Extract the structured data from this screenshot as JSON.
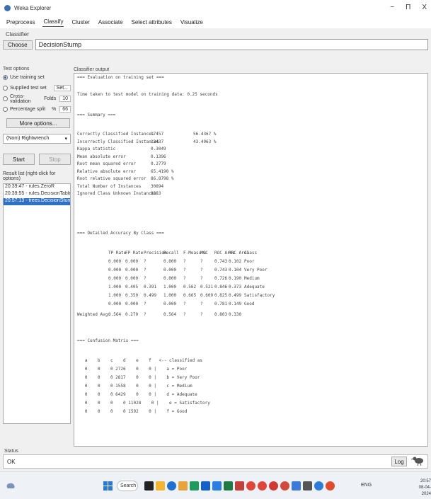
{
  "window": {
    "title": "Weka Explorer",
    "minimize": "−",
    "maximize": "Π",
    "close": "X"
  },
  "tabs": [
    "Preprocess",
    "Classify",
    "Cluster",
    "Associate",
    "Select attributes",
    "Visualize"
  ],
  "active_tab": 1,
  "classifier": {
    "section_label": "Classifier",
    "choose_label": "Choose",
    "name": "DecisionStump"
  },
  "test_options": {
    "title": "Test options",
    "use_training": "Use training set",
    "supplied": {
      "label": "Supplied test set",
      "button": "Set..."
    },
    "cross_val": {
      "label": "Cross-validation",
      "folds_label": "Folds",
      "folds": "10"
    },
    "split": {
      "label": "Percentage split",
      "pct_label": "%",
      "pct": "66"
    },
    "more_options": "More options..."
  },
  "class_select": {
    "value": "(Nom) Rightwrench",
    "arrow": "▾"
  },
  "start_label": "Start",
  "stop_label": "Stop",
  "result_list": {
    "title": "Result list (right-click for options)",
    "items": [
      "20:39:47 - rules.ZeroR",
      "20:39:55 - rules.DecisionTable",
      "20:57:13 - trees.DecisionStump"
    ]
  },
  "output": {
    "title": "Classifier output",
    "header_line": "=== Evaluation on training set ===",
    "time_line": "Time taken to test model on training data: 0.25 seconds",
    "summary_title": "=== Summary ===",
    "summary": [
      {
        "label": "Correctly Classified Instances",
        "value": "17457",
        "pct": "56.4367 %"
      },
      {
        "label": "Incorrectly Classified Instances",
        "value": "13437",
        "pct": "43.4963 %"
      },
      {
        "label": "Kappa statistic",
        "value": "0.3049"
      },
      {
        "label": "Mean absolute error",
        "value": "0.1396"
      },
      {
        "label": "Root mean squared error",
        "value": "0.2779"
      },
      {
        "label": "Relative absolute error",
        "value": "65.4190 %"
      },
      {
        "label": "Root relative squared error",
        "value": "86.8798 %"
      },
      {
        "label": "Total Number of Instances",
        "value": "30894"
      },
      {
        "label": "Ignored Class Unknown Instances",
        "value": "9283"
      }
    ],
    "detailed_title": "=== Detailed Accuracy By Class ===",
    "detailed_headers": [
      "TP Rate",
      "FP Rate",
      "Precision",
      "Recall",
      "F-Measure",
      "MCC",
      "ROC Area",
      "PRC Area",
      "Class"
    ],
    "detailed_rows": [
      [
        "0.000",
        "0.000",
        "?",
        "0.000",
        "?",
        "?",
        "0.743",
        "0.102",
        "Poor"
      ],
      [
        "0.000",
        "0.000",
        "?",
        "0.000",
        "?",
        "?",
        "0.743",
        "0.104",
        "Very Poor"
      ],
      [
        "0.000",
        "0.000",
        "?",
        "0.000",
        "?",
        "?",
        "0.726",
        "0.190",
        "Medium"
      ],
      [
        "1.000",
        "0.405",
        "0.391",
        "1.000",
        "0.562",
        "0.521",
        "0.846",
        "0.373",
        "Adequate"
      ],
      [
        "1.000",
        "0.350",
        "0.499",
        "1.000",
        "0.665",
        "0.609",
        "0.825",
        "0.499",
        "Satisfactory"
      ],
      [
        "0.000",
        "0.000",
        "?",
        "0.000",
        "?",
        "?",
        "0.781",
        "0.149",
        "Good"
      ]
    ],
    "weighted_label": "Weighted Avg.",
    "weighted_row": [
      "0.564",
      "0.279",
      "?",
      "0.564",
      "?",
      "?",
      "0.803",
      "0.330"
    ],
    "confusion_title": "=== Confusion Matrix ===",
    "confusion_header": "   a    b    c    d    e    f   <-- classified as",
    "confusion_rows": [
      "   0    0    0 2726    0    0 |    a = Poor",
      "   0    0    0 2817    0    0 |    b = Very Poor",
      "   0    0    0 1558    0    0 |    c = Medium",
      "   0    0    0 6429    0    0 |    d = Adequate",
      "   0    0    0    0 11028    0 |    e = Satisfactory",
      "   0    0    0    0 1592    0 |    f = Good"
    ]
  },
  "status": {
    "label": "Status",
    "text": "OK",
    "log_button": "Log"
  },
  "taskbar": {
    "search_label": "Search",
    "tray_text": "ENG",
    "time": "20:57",
    "date": "08-04-2024"
  },
  "colors": {
    "accent": "#2f6fc6",
    "window_bg": "#f0f0f0",
    "taskbar_bg": "#eef2f7"
  }
}
